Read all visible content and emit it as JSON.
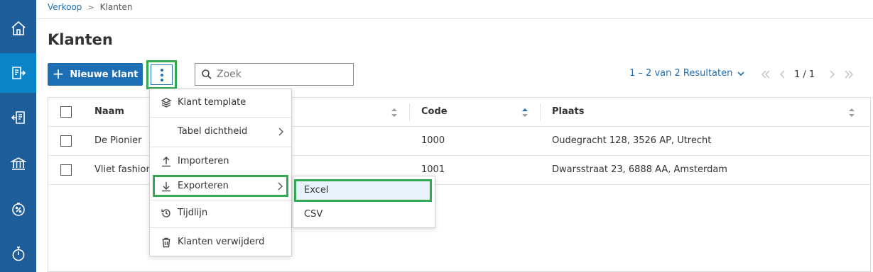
{
  "breadcrumb": {
    "parent": "Verkoop",
    "separator": ">",
    "current": "Klanten"
  },
  "page": {
    "title": "Klanten"
  },
  "toolbar": {
    "new_button_label": "Nieuwe klant",
    "search_placeholder": "Zoek",
    "results_text": "1 – 2 van 2 Resultaten",
    "page_indicator": "1 / 1"
  },
  "table": {
    "columns": [
      "Naam",
      "Code",
      "Plaats"
    ],
    "rows": [
      {
        "naam": "De Pionier",
        "code": "1000",
        "plaats": "Oudegracht 128, 3526 AP, Utrecht"
      },
      {
        "naam": "Vliet fashion",
        "code": "1001",
        "plaats": "Dwarsstraat 23, 6888 AA, Amsterdam"
      }
    ]
  },
  "menu": {
    "items": [
      {
        "label": "Klant template",
        "icon": "layers-icon"
      },
      {
        "label": "Tabel dichtheid",
        "icon": ""
      },
      {
        "label": "Importeren",
        "icon": "upload-icon"
      },
      {
        "label": "Exporteren",
        "icon": "download-icon"
      },
      {
        "label": "Tijdlijn",
        "icon": "history-icon"
      },
      {
        "label": "Klanten verwijderd",
        "icon": "trash-icon"
      }
    ]
  },
  "submenu": {
    "items": [
      "Excel",
      "CSV"
    ]
  },
  "colors": {
    "sidebar": "#1d5d99",
    "sidebar_active": "#0a84c6",
    "primary": "#1d6fb5",
    "highlight": "#34a853"
  }
}
